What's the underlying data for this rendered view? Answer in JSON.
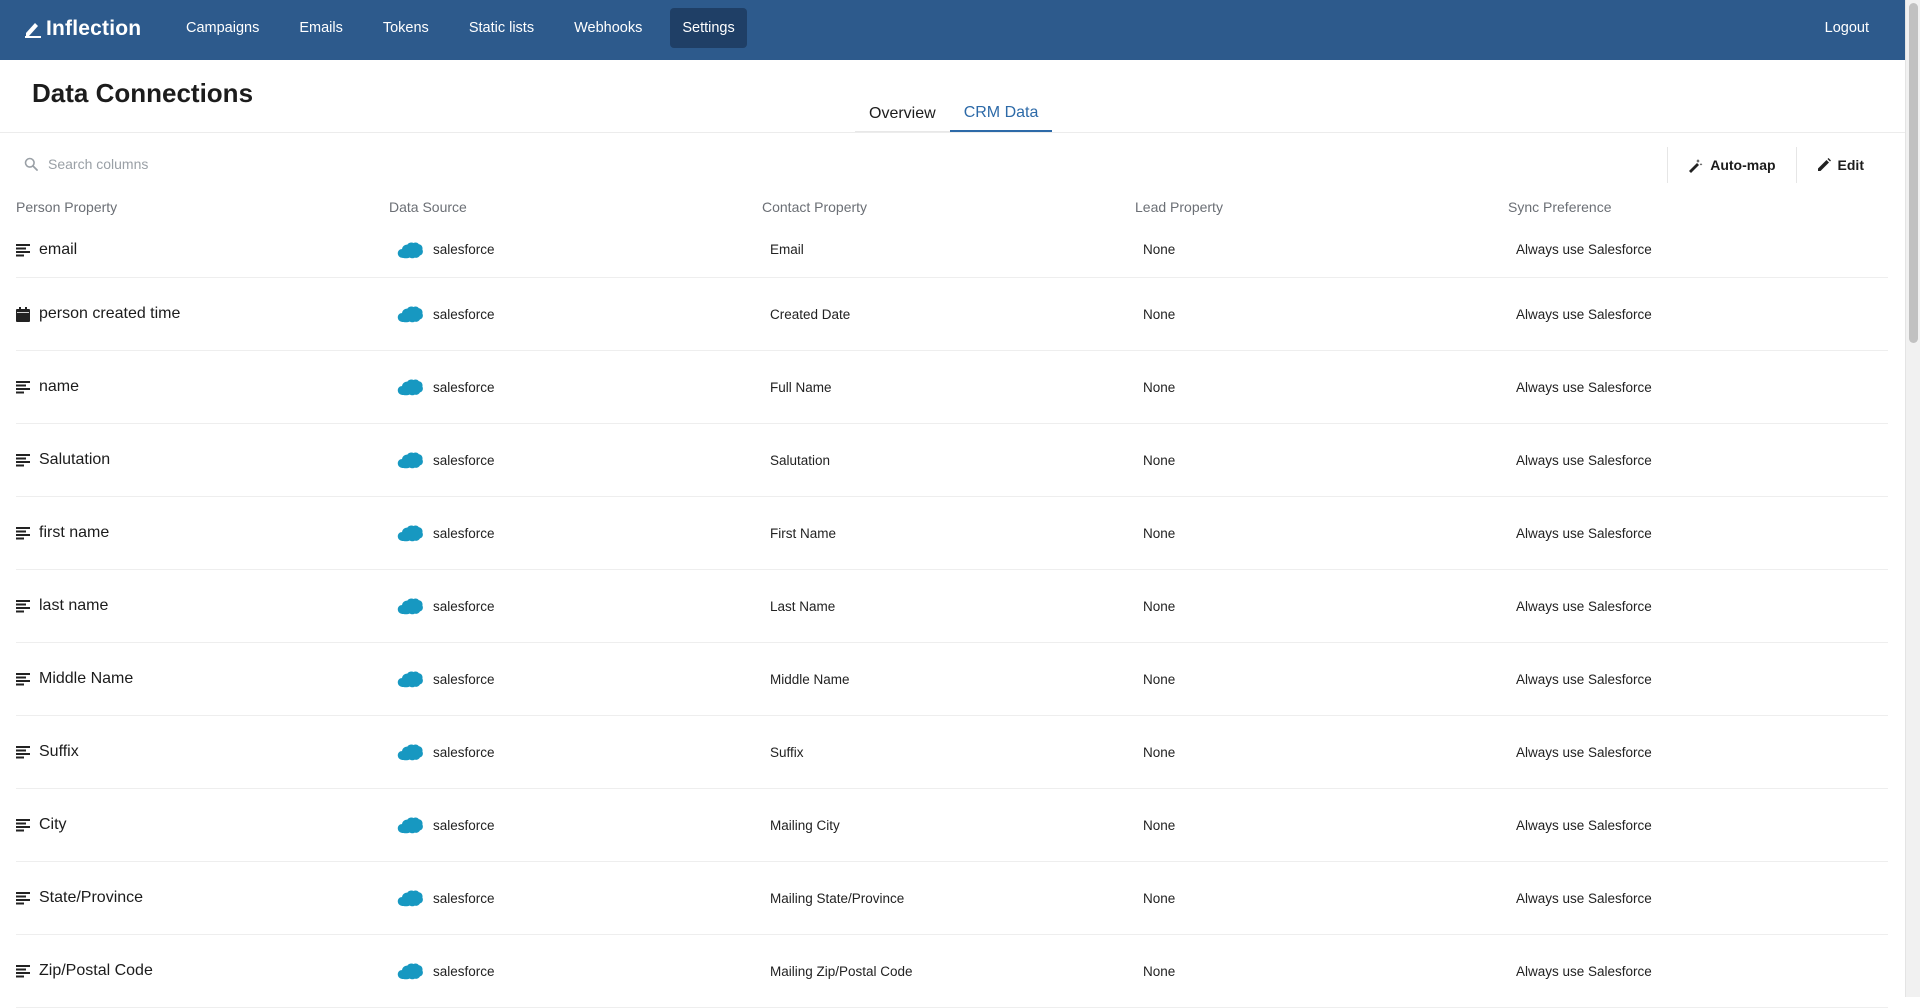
{
  "app": {
    "brand": "Inflection",
    "nav": [
      {
        "label": "Campaigns",
        "active": false
      },
      {
        "label": "Emails",
        "active": false
      },
      {
        "label": "Tokens",
        "active": false
      },
      {
        "label": "Static lists",
        "active": false
      },
      {
        "label": "Webhooks",
        "active": false
      },
      {
        "label": "Settings",
        "active": true
      }
    ],
    "logout_label": "Logout",
    "colors": {
      "topbar": "#2d5a8c",
      "accent": "#2d6aa8",
      "salesforce": "#1798c1"
    }
  },
  "page": {
    "title": "Data Connections",
    "tabs": [
      {
        "label": "Overview",
        "active": false
      },
      {
        "label": "CRM Data",
        "active": true
      }
    ]
  },
  "toolbar": {
    "search_placeholder": "Search columns",
    "automap_label": "Auto-map",
    "edit_label": "Edit"
  },
  "table": {
    "headers": [
      "Person Property",
      "Data Source",
      "Contact Property",
      "Lead Property",
      "Sync Preference"
    ],
    "rows": [
      {
        "icon": "text-icon",
        "person": "email",
        "source": "salesforce",
        "contact": "Email",
        "lead": "None",
        "sync": "Always use Salesforce"
      },
      {
        "icon": "calendar-icon",
        "person": "person created time",
        "source": "salesforce",
        "contact": "Created Date",
        "lead": "None",
        "sync": "Always use Salesforce"
      },
      {
        "icon": "text-icon",
        "person": "name",
        "source": "salesforce",
        "contact": "Full Name",
        "lead": "None",
        "sync": "Always use Salesforce"
      },
      {
        "icon": "text-icon",
        "person": "Salutation",
        "source": "salesforce",
        "contact": "Salutation",
        "lead": "None",
        "sync": "Always use Salesforce"
      },
      {
        "icon": "text-icon",
        "person": "first name",
        "source": "salesforce",
        "contact": "First Name",
        "lead": "None",
        "sync": "Always use Salesforce"
      },
      {
        "icon": "text-icon",
        "person": "last name",
        "source": "salesforce",
        "contact": "Last Name",
        "lead": "None",
        "sync": "Always use Salesforce"
      },
      {
        "icon": "text-icon",
        "person": "Middle Name",
        "source": "salesforce",
        "contact": "Middle Name",
        "lead": "None",
        "sync": "Always use Salesforce"
      },
      {
        "icon": "text-icon",
        "person": "Suffix",
        "source": "salesforce",
        "contact": "Suffix",
        "lead": "None",
        "sync": "Always use Salesforce"
      },
      {
        "icon": "text-icon",
        "person": "City",
        "source": "salesforce",
        "contact": "Mailing City",
        "lead": "None",
        "sync": "Always use Salesforce"
      },
      {
        "icon": "text-icon",
        "person": "State/Province",
        "source": "salesforce",
        "contact": "Mailing State/Province",
        "lead": "None",
        "sync": "Always use Salesforce"
      },
      {
        "icon": "text-icon",
        "person": "Zip/Postal Code",
        "source": "salesforce",
        "contact": "Mailing Zip/Postal Code",
        "lead": "None",
        "sync": "Always use Salesforce"
      }
    ]
  }
}
